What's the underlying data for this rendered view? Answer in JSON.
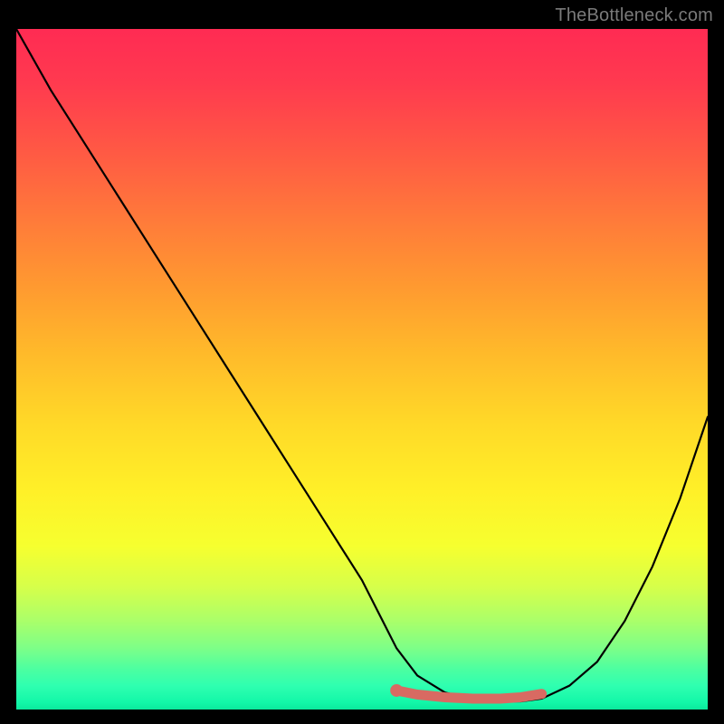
{
  "watermark": "TheBottleneck.com",
  "chart_data": {
    "type": "line",
    "title": "",
    "xlabel": "",
    "ylabel": "",
    "xlim": [
      0,
      100
    ],
    "ylim": [
      0,
      100
    ],
    "grid": false,
    "legend": false,
    "series": [
      {
        "name": "curve",
        "color": "#000000",
        "x": [
          0,
          5,
          10,
          15,
          20,
          25,
          30,
          35,
          40,
          45,
          50,
          53,
          55,
          58,
          62,
          66,
          70,
          73,
          76,
          80,
          84,
          88,
          92,
          96,
          100
        ],
        "y": [
          100,
          91,
          83,
          75,
          67,
          59,
          51,
          43,
          35,
          27,
          19,
          13,
          9,
          5,
          2.5,
          1.5,
          1.2,
          1.2,
          1.6,
          3.5,
          7,
          13,
          21,
          31,
          43
        ]
      },
      {
        "name": "highlight",
        "color": "#d86a62",
        "x": [
          55,
          58,
          62,
          66,
          70,
          73,
          76
        ],
        "y": [
          2.8,
          2.2,
          1.8,
          1.6,
          1.6,
          1.8,
          2.3
        ]
      }
    ],
    "points": [
      {
        "name": "highlight-start-dot",
        "x": 55,
        "y": 2.8,
        "color": "#d86a62"
      }
    ],
    "background_gradient": {
      "direction": "vertical",
      "stops": [
        {
          "pos": 0.0,
          "color": "#ff2b53"
        },
        {
          "pos": 0.5,
          "color": "#ffd928"
        },
        {
          "pos": 0.8,
          "color": "#f6ff2f"
        },
        {
          "pos": 1.0,
          "color": "#0be89c"
        }
      ]
    }
  }
}
